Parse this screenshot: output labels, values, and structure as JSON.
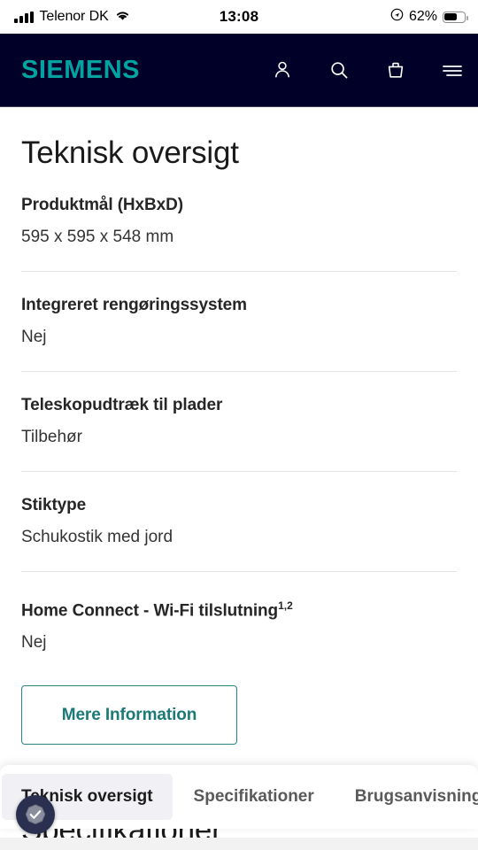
{
  "statusbar": {
    "carrier": "Telenor DK",
    "time": "13:08",
    "battery_percent": "62%",
    "signal_icon": "cellular-signal-icon",
    "wifi_icon": "wifi-icon",
    "location_icon": "location-arrow-icon",
    "battery_icon": "battery-icon"
  },
  "header": {
    "logo": "SIEMENS",
    "logo_color": "#00a3a0",
    "background_color": "#000028",
    "icons": [
      {
        "name": "account-icon",
        "label": "Konto"
      },
      {
        "name": "search-icon",
        "label": "Søg"
      },
      {
        "name": "shopping-bag-icon",
        "label": "Kurv"
      },
      {
        "name": "hamburger-menu-icon",
        "label": "Menu"
      }
    ]
  },
  "main": {
    "title": "Teknisk oversigt",
    "specs": [
      {
        "label": "Produktmål (HxBxD)",
        "sup": "",
        "value": "595 x 595 x 548 mm"
      },
      {
        "label": "Integreret rengøringssystem",
        "sup": "",
        "value": "Nej"
      },
      {
        "label": "Teleskopudtræk til plader",
        "sup": "",
        "value": "Tilbehør"
      },
      {
        "label": "Stiktype",
        "sup": "",
        "value": "Schukostik med jord"
      },
      {
        "label": "Home Connect - Wi-Fi tilslutning",
        "sup": "1,2",
        "value": "Nej"
      }
    ],
    "more_button": "Mere Information",
    "next_section_heading": "Specifikationer"
  },
  "tabbar": {
    "accent_color": "#f1f0f5",
    "tabs": [
      {
        "label": "Teknisk oversigt",
        "active": true
      },
      {
        "label": "Specifikationer",
        "active": false
      },
      {
        "label": "Brugsanvisning og d",
        "active": false
      }
    ]
  },
  "trust_badge": {
    "name": "verified-shield-badge"
  }
}
